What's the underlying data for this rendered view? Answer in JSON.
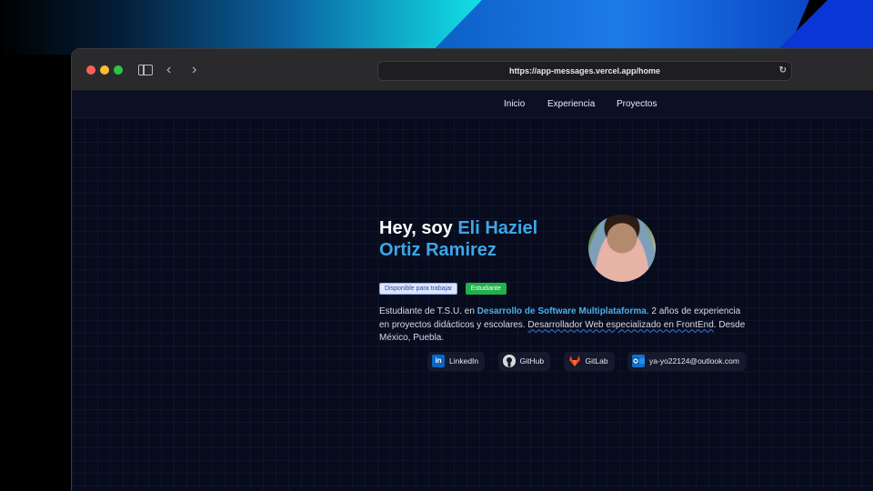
{
  "browser": {
    "url": "https://app-messages.vercel.app/home"
  },
  "nav": {
    "items": [
      "Inicio",
      "Experiencia",
      "Proyectos"
    ]
  },
  "hero": {
    "greeting": "Hey, soy ",
    "name_line1": "Eli Haziel",
    "name_line2": "Ortiz Ramirez",
    "badges": [
      "Disponible para trabajar",
      "Estudiante"
    ],
    "desc_part1": "Estudiante de T.S.U. en ",
    "desc_bold": "Desarrollo de Software Multiplataforma",
    "desc_part2": ". 2 años de experiencia en proyectos didácticos y escolares. ",
    "desc_wavy": "Desarrollador Web especializado en FrontEnd",
    "desc_part3": ". Desde México, Puebla."
  },
  "links": {
    "linkedin": "LinkedIn",
    "github": "GitHub",
    "gitlab": "GitLab",
    "email": "ya-yo22124@outlook.com"
  },
  "icons": {
    "linkedin": "linkedin-icon",
    "github": "github-icon",
    "gitlab": "gitlab-icon",
    "email": "outlook-icon"
  },
  "colors": {
    "accent": "#3ea6e6",
    "badge_student": "#22b04a",
    "badge_available": "#dce6fb"
  }
}
